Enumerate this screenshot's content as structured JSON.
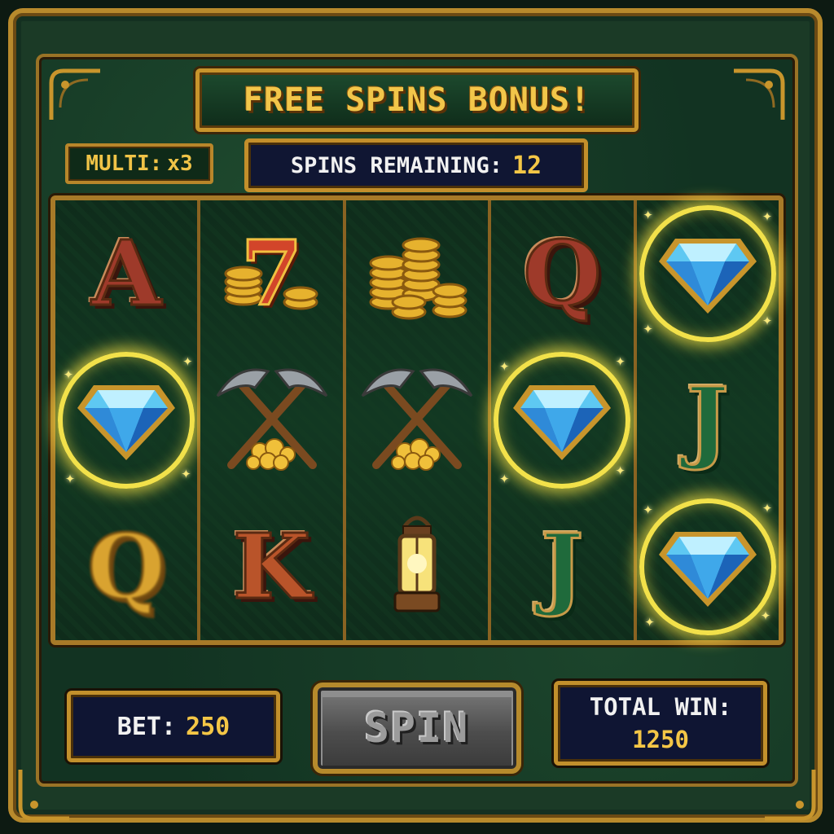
{
  "header": {
    "banner_title": "FREE SPINS BONUS!",
    "multiplier_label": "MULTI:",
    "multiplier_value": "x3",
    "spins_label": "SPINS REMAINING:",
    "spins_value": "12"
  },
  "reels": [
    [
      "letter-A",
      "diamond",
      "letter-Q"
    ],
    [
      "lucky-seven-coins",
      "crossed-pickaxes-gold",
      "letter-K"
    ],
    [
      "gold-coin-stacks",
      "crossed-pickaxes-gold",
      "mining-lantern"
    ],
    [
      "letter-Q",
      "diamond",
      "letter-J"
    ],
    [
      "diamond",
      "letter-J",
      "diamond"
    ]
  ],
  "symbol_text": {
    "a": "A",
    "q": "Q",
    "k": "K",
    "j": "J",
    "seven": "7"
  },
  "footer": {
    "bet_label": "BET:",
    "bet_value": "250",
    "spin_label": "SPIN",
    "total_win_label": "TOTAL WIN:",
    "total_win_value": "1250"
  },
  "colors": {
    "frame_gold": "#c8952c",
    "felt_green": "#123322",
    "panel_navy": "#101633",
    "accent_gold_text": "#f4c646",
    "win_glow": "#f2e14a"
  }
}
